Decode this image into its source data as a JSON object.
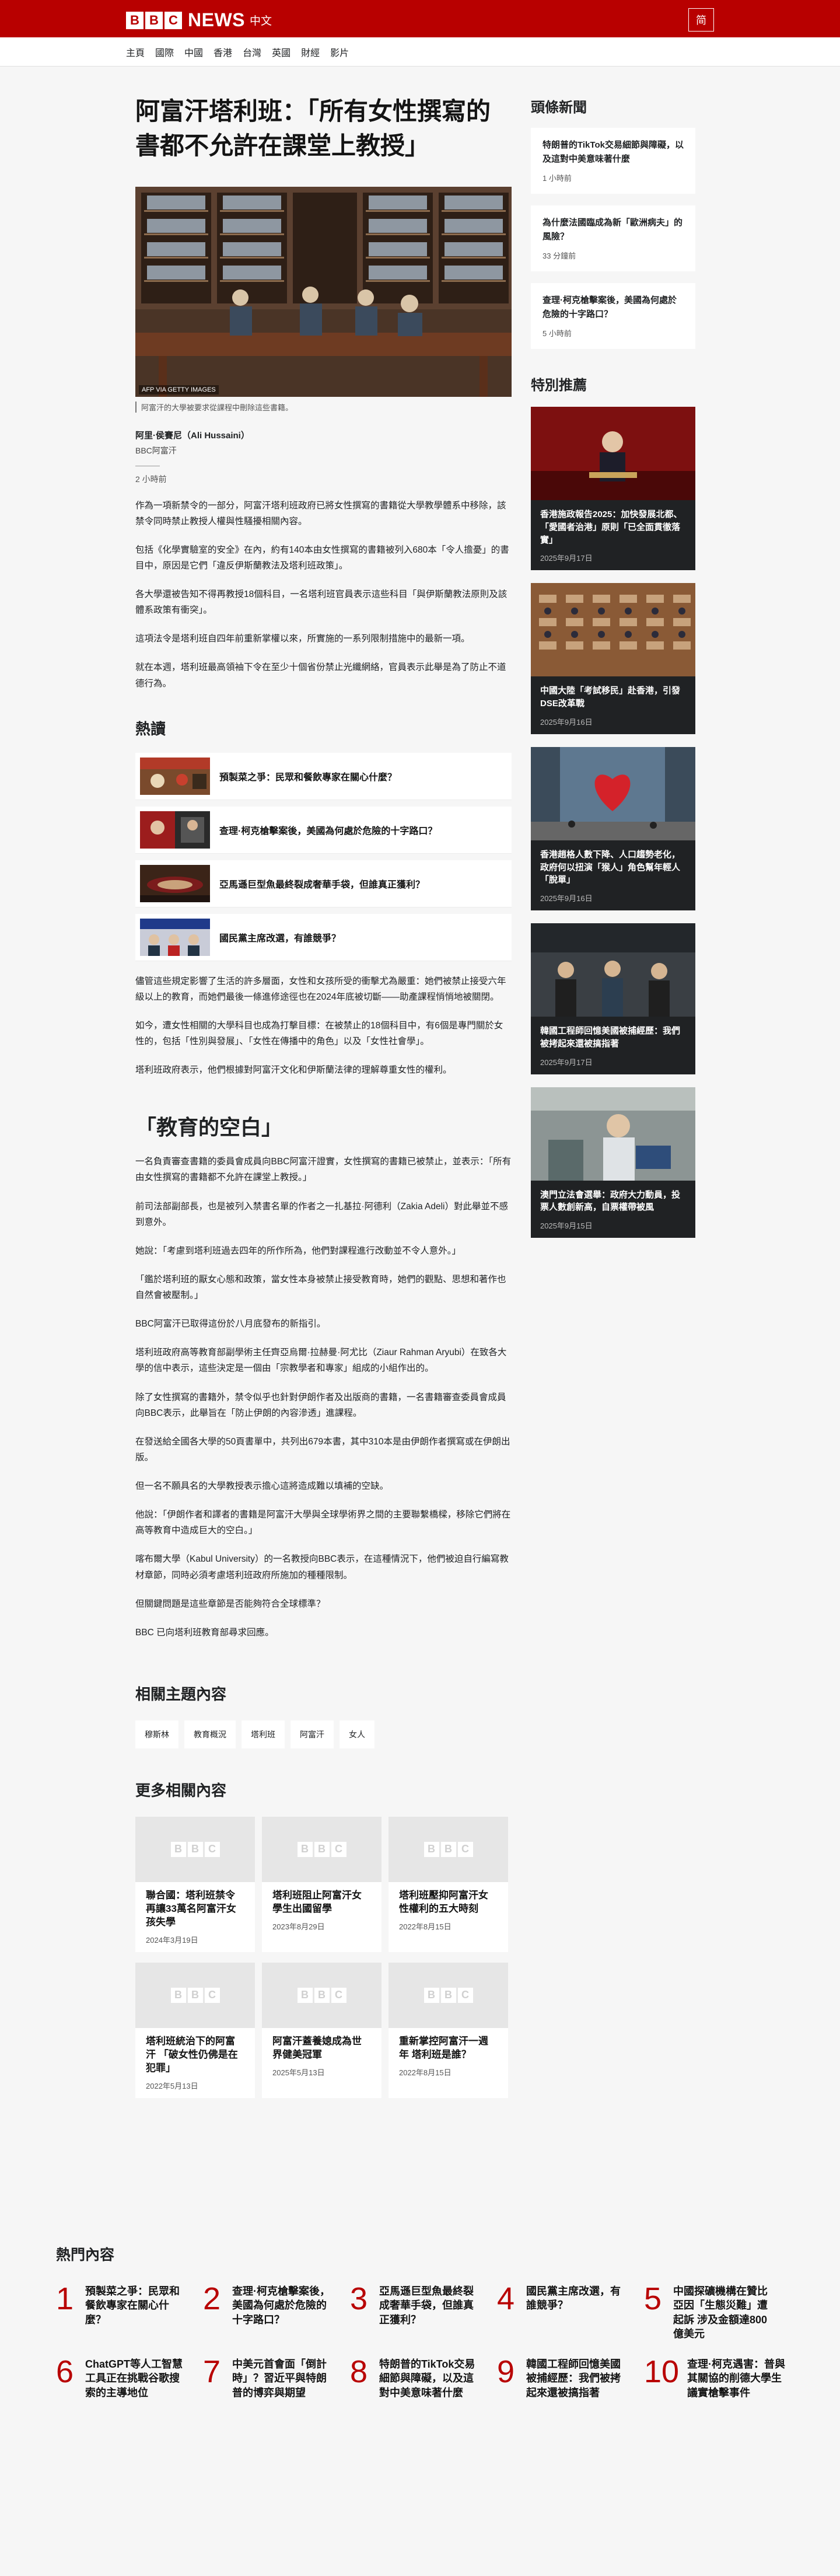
{
  "header": {
    "brand_blocks": [
      "B",
      "B",
      "C"
    ],
    "brand_news": "NEWS",
    "brand_zh": "中文",
    "script_toggle": "简"
  },
  "nav": [
    "主頁",
    "國際",
    "中國",
    "香港",
    "台灣",
    "英國",
    "財經",
    "影片"
  ],
  "article": {
    "headline": "阿富汗塔利班：「所有女性撰寫的書都不允許在課堂上教授」",
    "image_credit": "AFP VIA GETTY IMAGES",
    "image_caption": "阿富汗的大學被要求從課程中刪除這些書籍。",
    "author_name": "阿里·侯賽尼（Ali Hussaini）",
    "author_role": "BBC阿富汗",
    "timestamp": "2 小時前",
    "paras_a": [
      "作為一項新禁令的一部分，阿富汗塔利班政府已將女性撰寫的書籍從大學教學體系中移除，該禁令同時禁止教授人權與性騷擾相關內容。",
      "包括《化學實驗室的安全》在內，約有140本由女性撰寫的書籍被列入680本「令人擔憂」的書目中，原因是它們「違反伊斯蘭教法及塔利班政策」。",
      "各大學還被告知不得再教授18個科目，一名塔利班官員表示這些科目「與伊斯蘭教法原則及該體系政策有衝突」。",
      "這項法令是塔利班自四年前重新掌權以來，所實施的一系列限制措施中的最新一項。",
      "就在本週，塔利班最高領袖下令在至少十個省份禁止光纖網絡，官員表示此舉是為了防止不道德行為。"
    ],
    "hot_heading": "熱讀",
    "hot_items": [
      "預製菜之爭：民眾和餐飲專家在關心什麼？",
      "查理·柯克槍擊案後，美國為何處於危險的十字路口？",
      "亞馬遜巨型魚最終裂成奢華手袋，但誰真正獲利？",
      "國民黨主席改選，有誰競爭？"
    ],
    "paras_b": [
      "儘管這些規定影響了生活的許多層面，女性和女孩所受的衝擊尤為嚴重：她們被禁止接受六年級以上的教育，而她們最後一條進修途徑也在2024年底被切斷——助產課程悄悄地被關閉。",
      "如今，遭女性相關的大學科目也成為打擊目標：在被禁止的18個科目中，有6個是專門關於女性的，包括「性別與發展」、「女性在傳播中的角色」以及「女性社會學」。",
      "塔利班政府表示，他們根據對阿富汗文化和伊斯蘭法律的理解尊重女性的權利。"
    ],
    "section2_heading": "「教育的空白」",
    "paras_c": [
      "一名負責審查書籍的委員會成員向BBC阿富汗證實，女性撰寫的書籍已被禁止，並表示：「所有由女性撰寫的書籍都不允許在課堂上教授。」",
      "前司法部副部長，也是被列入禁書名單的作者之一扎基拉·阿德利（Zakia Adeli）對此舉並不感到意外。",
      "她說：「考慮到塔利班過去四年的所作所為，他們對課程進行改動並不令人意外。」",
      "「鑑於塔利班的厭女心態和政策，當女性本身被禁止接受教育時，她們的觀點、思想和著作也自然會被壓制。」",
      "BBC阿富汗已取得這份於八月底發布的新指引。",
      "塔利班政府高等教育部副學術主任齊亞烏爾·拉赫曼·阿尤比（Ziaur Rahman Aryubi）在致各大學的信中表示，這些決定是一個由「宗教學者和專家」組成的小組作出的。",
      "除了女性撰寫的書籍外，禁令似乎也針對伊朗作者及出版商的書籍，一名書籍審查委員會成員向BBC表示，此舉旨在「防止伊朗的內容滲透」進課程。",
      "在發送給全國各大學的50頁書單中，共列出679本書，其中310本是由伊朗作者撰寫或在伊朗出版。",
      "但一名不願具名的大學教授表示擔心這將造成難以填補的空缺。",
      "他說：「伊朗作者和譯者的書籍是阿富汗大學與全球學術界之間的主要聯繫橋樑，移除它們將在高等教育中造成巨大的空白。」",
      "喀布爾大學（Kabul University）的一名教授向BBC表示，在這種情況下，他們被迫自行編寫教材章節，同時必須考慮塔利班政府所施加的種種限制。",
      "但關鍵問題是這些章節是否能夠符合全球標準？",
      "BBC 已向塔利班教育部尋求回應。"
    ],
    "related_heading": "相關主題內容",
    "tags": [
      "穆斯林",
      "教育概況",
      "塔利班",
      "阿富汗",
      "女人"
    ],
    "more_heading": "更多相關內容",
    "more_items": [
      {
        "title": "聯合國：塔利班禁令再讓33萬名阿富汗女孩失學",
        "date": "2024年3月19日"
      },
      {
        "title": "塔利班阻止阿富汗女學生出國留學",
        "date": "2023年8月29日"
      },
      {
        "title": "塔利班壓抑阿富汗女性權利的五大時刻",
        "date": "2022年8月15日"
      },
      {
        "title": "塔利班統治下的阿富汗 「破女性仍佛是在犯罪」",
        "date": "2022年5月13日"
      },
      {
        "title": "阿富汗蓋養媳成為世界健美冠軍",
        "date": "2025年5月13日"
      },
      {
        "title": "重新掌控阿富汗一週年 塔利班是誰？",
        "date": "2022年8月15日"
      }
    ]
  },
  "sidebar": {
    "top_heading": "頭條新聞",
    "top_news": [
      {
        "title": "特朗普的TikTok交易細節與障礙，以及這對中美意味著什麼",
        "time": "1 小時前"
      },
      {
        "title": "為什麼法國臨成為新「歐洲病夫」的風險？",
        "time": "33 分鐘前"
      },
      {
        "title": "查理·柯克槍擊案後，美國為何處於危險的十字路口？",
        "time": "5 小時前"
      }
    ],
    "featured_heading": "特別推薦",
    "featured": [
      {
        "title": "香港施政報告2025：加快發展北都、「愛國者治港」原則「已全面貫徹落實」",
        "date": "2025年9月17日"
      },
      {
        "title": "中國大陸「考試移民」赴香港，引發DSE改革戰",
        "date": "2025年9月16日"
      },
      {
        "title": "香港趙格人數下降、人口趨勢老化，政府何以扭演「猴人」角色幫年輕人「脫單」",
        "date": "2025年9月16日"
      },
      {
        "title": "韓國工程師回憶美國被捕經歷：我們被拷起來還被搞指著",
        "date": "2025年9月17日"
      },
      {
        "title": "澳門立法會選舉：政府大力動員，投票人數創新高，自票權帶被風",
        "date": "2025年9月15日"
      }
    ]
  },
  "most_read": {
    "heading": "熱門內容",
    "items": [
      {
        "num": "1",
        "title": "預製菜之爭：民眾和餐飲專家在關心什麼？"
      },
      {
        "num": "2",
        "title": "查理·柯克槍擊案後，美國為何處於危險的十字路口？"
      },
      {
        "num": "3",
        "title": "亞馬遜巨型魚最終裂成奢華手袋，但誰真正獲利？"
      },
      {
        "num": "4",
        "title": "國民黨主席改選，有誰競爭？"
      },
      {
        "num": "5",
        "title": "中國探礦機構在贊比亞因「生態災難」遭起訴 涉及金額達800億美元"
      },
      {
        "num": "6",
        "title": "ChatGPT等人工智慧工具正在挑戰谷歌搜索的主導地位"
      },
      {
        "num": "7",
        "title": "中美元首會面「倒計時」？習近平與特朗普的博弈與期望"
      },
      {
        "num": "8",
        "title": "特朗普的TikTok交易細節與障礙，以及這對中美意味著什麼"
      },
      {
        "num": "9",
        "title": "韓國工程師回憶美國被捕經歷：我們被拷起來還被搞指著"
      },
      {
        "num": "10",
        "title": "查理·柯克遇害：普與其關協的削德大學生議實槍擊事件"
      }
    ]
  },
  "colors": {
    "brand_red": "#b80000",
    "page_bg": "#f6f6f6",
    "card_bg": "#ffffff",
    "dark_card": "#202224"
  }
}
